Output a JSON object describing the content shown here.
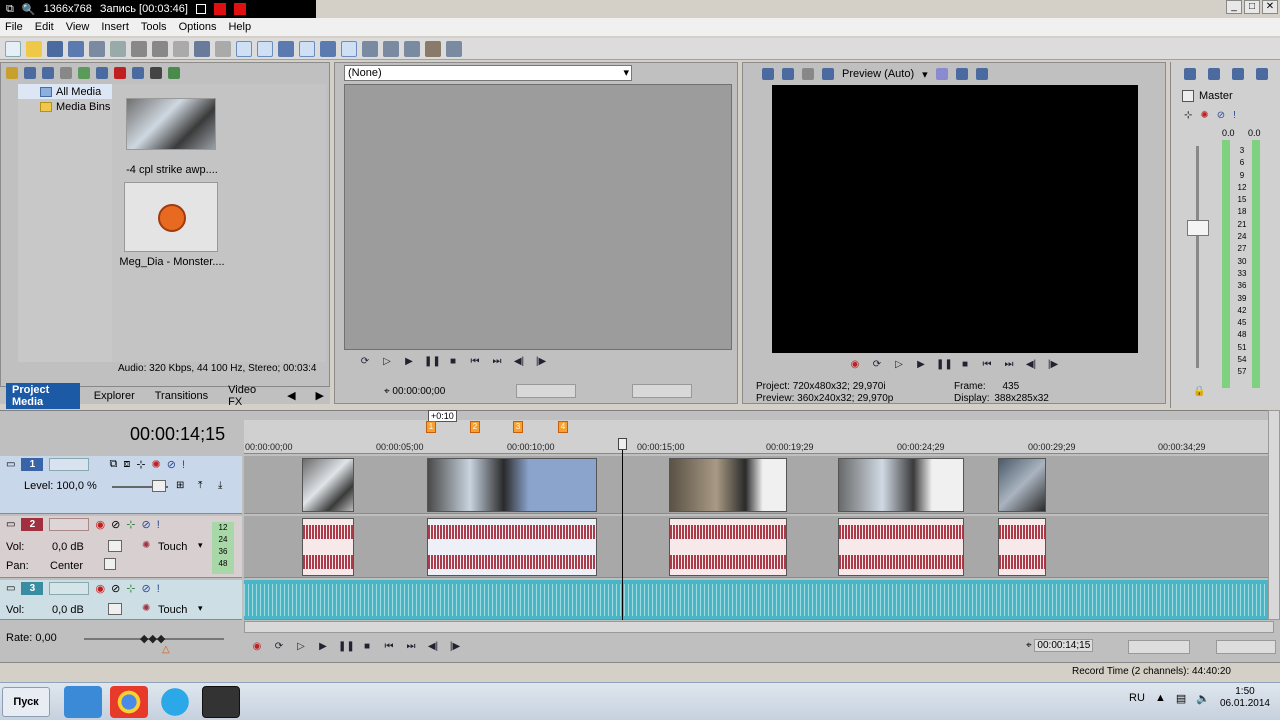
{
  "recorder": {
    "resolution": "1366x768",
    "recording": "Запись [00:03:46]"
  },
  "menu": [
    "File",
    "Edit",
    "View",
    "Insert",
    "Tools",
    "Options",
    "Help"
  ],
  "explorer": {
    "tree": [
      "All Media",
      "Media Bins"
    ],
    "media": [
      {
        "label": "-4 cpl strike awp...."
      },
      {
        "label": "Meg_Dia - Monster...."
      }
    ],
    "info": "Audio: 320 Kbps, 44 100 Hz, Stereo; 00:03:4",
    "tabs": [
      "Project Media",
      "Explorer",
      "Transitions",
      "Video FX"
    ]
  },
  "trimmer": {
    "selection": "(None)",
    "time": "00:00:00;00"
  },
  "preview": {
    "mode": "Preview (Auto)",
    "project_label": "Project:",
    "project_value": "720x480x32; 29,970i",
    "preview_label": "Preview:",
    "preview_value": "360x240x32; 29,970p",
    "frame_label": "Frame:",
    "frame_value": "435",
    "display_label": "Display:",
    "display_value": "388x285x32"
  },
  "mixer": {
    "title": "Master",
    "db_left": "0.0",
    "db_right": "0.0",
    "scale": [
      "3",
      "6",
      "9",
      "12",
      "15",
      "18",
      "21",
      "24",
      "27",
      "30",
      "33",
      "36",
      "39",
      "42",
      "45",
      "48",
      "51",
      "54",
      "57"
    ]
  },
  "timeline": {
    "current_time": "00:00:14;15",
    "ruler": [
      "00:00:00;00",
      "00:00:05;00",
      "00:00:10;00",
      "00:00:15;00",
      "00:00:19;29",
      "00:00:24;29",
      "00:00:29;29",
      "00:00:34;29"
    ],
    "marker_tooltip": "+0:10",
    "markers": [
      "1",
      "2",
      "3",
      "4"
    ],
    "tracks": [
      {
        "num": "1",
        "level_label": "Level: 100,0 %"
      },
      {
        "num": "2",
        "vol_label": "Vol:",
        "vol_value": "0,0 dB",
        "pan_label": "Pan:",
        "pan_value": "Center",
        "mode": "Touch",
        "meter": [
          "12",
          "24",
          "36",
          "48"
        ]
      },
      {
        "num": "3",
        "vol_label": "Vol:",
        "vol_value": "0,0 dB",
        "mode": "Touch"
      }
    ],
    "rate": "Rate: 0,00",
    "transport_time": "00:00:14;15",
    "record_time": "Record Time (2 channels): 44:40:20"
  },
  "taskbar": {
    "start": "Пуск",
    "lang": "RU",
    "time": "1:50",
    "date": "06.01.2014"
  },
  "colors": {
    "accent": "#1c5aa6",
    "track1": "#3a64a8",
    "track2": "#a03040",
    "track3": "#3a8ca0",
    "audio_clip": "#a01c2c",
    "music_lane": "#48b6c4"
  }
}
